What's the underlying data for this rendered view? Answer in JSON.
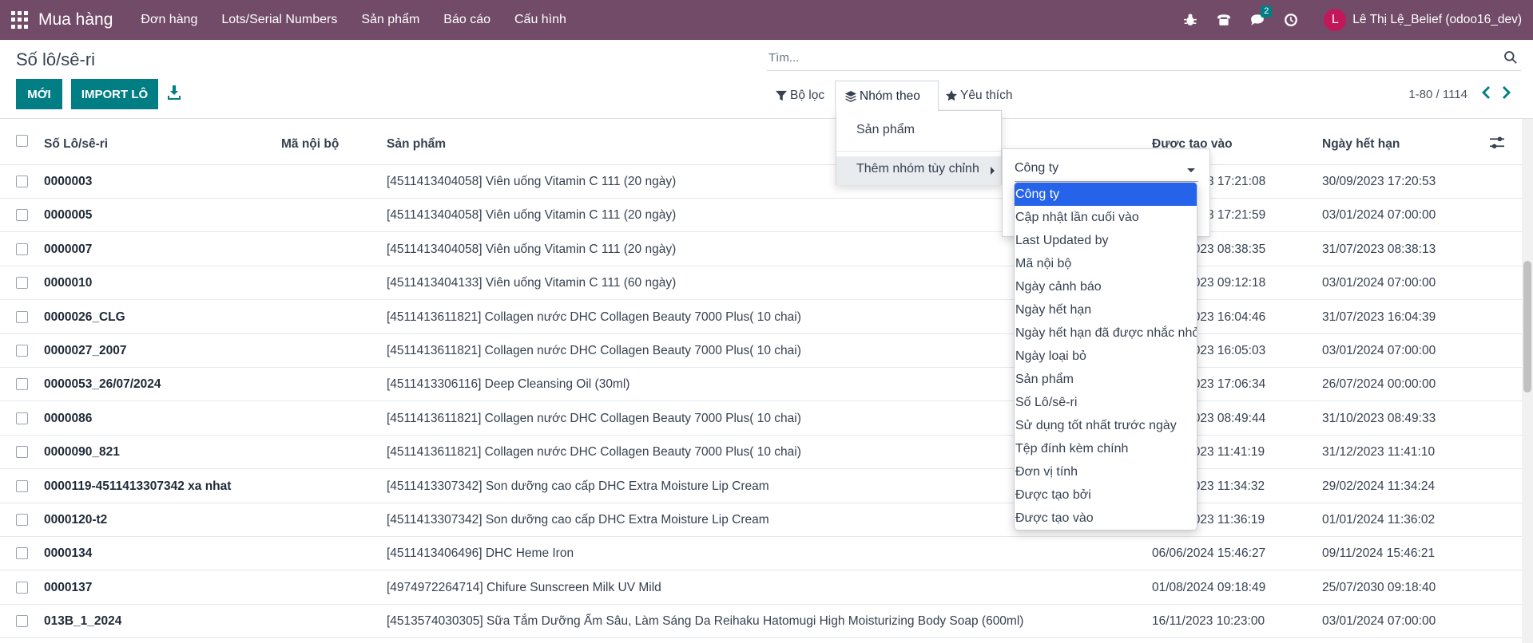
{
  "navbar": {
    "brand": "Mua hàng",
    "menu": [
      "Đơn hàng",
      "Lots/Serial Numbers",
      "Sản phẩm",
      "Báo cáo",
      "Cấu hình"
    ],
    "chat_badge": "2",
    "avatar_initial": "L",
    "user": "Lê Thị Lệ_Belief (odoo16_dev)",
    "bg_color": "#714b67"
  },
  "control": {
    "title": "Số lô/sê-ri",
    "new_label": "MỚI",
    "import_label": "IMPORT LÔ",
    "search_placeholder": "Tìm...",
    "filter_label": "Bộ lọc",
    "groupby_label": "Nhóm theo",
    "favorites_label": "Yêu thích",
    "pager": "1-80 / 1114",
    "accent": "#017e84"
  },
  "table": {
    "headers": [
      "Số Lô/sê-ri",
      "Mã nội bộ",
      "Sản phẩm",
      "Được tạo vào",
      "Ngày hết hạn"
    ],
    "rows": [
      {
        "lot": "0000003",
        "product": "[4511413404058] Viên uống Vitamin C 111 (20 ngày)",
        "created": "06/06/2023 17:21:08",
        "expiry": "30/09/2023 17:20:53"
      },
      {
        "lot": "0000005",
        "product": "[4511413404058] Viên uống Vitamin C 111 (20 ngày)",
        "created": "06/06/2023 17:21:59",
        "expiry": "03/01/2024 07:00:00"
      },
      {
        "lot": "0000007",
        "product": "[4511413404058] Viên uống Vitamin C 111 (20 ngày)",
        "created": "31/07/2023 08:38:35",
        "expiry": "31/07/2023 08:38:13"
      },
      {
        "lot": "0000010",
        "product": "[4511413404133] Viên uống Vitamin C 111 (60 ngày)",
        "created": "15/08/2023 09:12:18",
        "expiry": "03/01/2024 07:00:00"
      },
      {
        "lot": "0000026_CLG",
        "product": "[4511413611821] Collagen nước DHC Collagen Beauty 7000 Plus( 10 chai)",
        "created": "31/07/2023 16:04:46",
        "expiry": "31/07/2023 16:04:39"
      },
      {
        "lot": "0000027_2007",
        "product": "[4511413611821] Collagen nước DHC Collagen Beauty 7000 Plus( 10 chai)",
        "created": "20/07/2023 16:05:03",
        "expiry": "03/01/2024 07:00:00"
      },
      {
        "lot": "0000053_26/07/2024",
        "product": "[4511413306116] Deep Cleansing Oil (30ml)",
        "created": "26/07/2023 17:06:34",
        "expiry": "26/07/2024 00:00:00"
      },
      {
        "lot": "0000086",
        "product": "[4511413611821] Collagen nước DHC Collagen Beauty 7000 Plus( 10 chai)",
        "created": "31/10/2023 08:49:44",
        "expiry": "31/10/2023 08:49:33"
      },
      {
        "lot": "0000090_821",
        "product": "[4511413611821] Collagen nước DHC Collagen Beauty 7000 Plus( 10 chai)",
        "created": "31/12/2023 11:41:19",
        "expiry": "31/12/2023 11:41:10"
      },
      {
        "lot": "0000119-4511413307342 xa nhat",
        "product": "[4511413307342] Son dưỡng cao cấp DHC Extra Moisture Lip Cream",
        "created": "29/02/2023 11:34:32",
        "expiry": "29/02/2024 11:34:24"
      },
      {
        "lot": "0000120-t2",
        "product": "[4511413307342] Son dưỡng cao cấp DHC Extra Moisture Lip Cream",
        "created": "01/01/2023 11:36:19",
        "expiry": "01/01/2024 11:36:02"
      },
      {
        "lot": "0000134",
        "product": "[4511413406496] DHC Heme Iron",
        "created": "06/06/2024 15:46:27",
        "expiry": "09/11/2024 15:46:21"
      },
      {
        "lot": "0000137",
        "product": "[4974972264714] Chifure Sunscreen Milk UV Mild",
        "created": "01/08/2024 09:18:49",
        "expiry": "25/07/2030 09:18:40"
      },
      {
        "lot": "013B_1_2024",
        "product": "[4513574030305] Sữa Tắm Dưỡng Ẩm Sâu, Làm Sáng Da Reihaku Hatomugi High Moisturizing Body Soap (600ml)",
        "created": "16/11/2023 10:23:00",
        "expiry": "03/01/2024 07:00:00"
      }
    ]
  },
  "groupby_menu": {
    "option_product": "Sản phẩm",
    "custom_label": "Thêm nhóm tùy chỉnh",
    "select_value": "Công ty",
    "options": [
      "Công ty",
      "Cập nhật lần cuối vào",
      "Last Updated by",
      "Mã nội bộ",
      "Ngày cảnh báo",
      "Ngày hết hạn",
      "Ngày hết hạn đã được nhắc nhở",
      "Ngày loại bỏ",
      "Sản phẩm",
      "Số Lô/sê-ri",
      "Sử dụng tốt nhất trước ngày",
      "Tệp đính kèm chính",
      "Đơn vị tính",
      "Được tạo bởi",
      "Được tạo vào"
    ],
    "selected_color": "#2563eb"
  }
}
